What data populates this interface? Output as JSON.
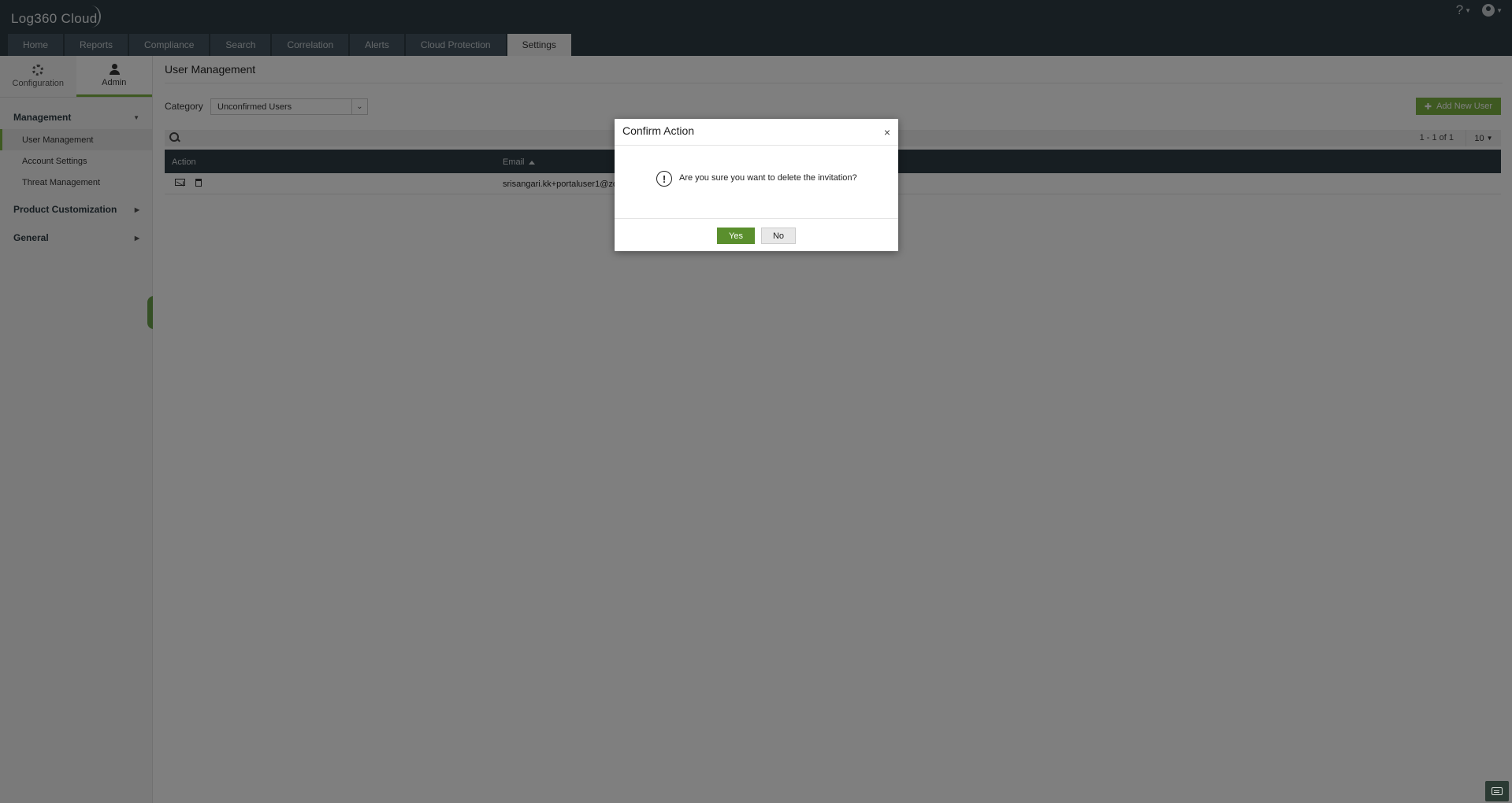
{
  "app": {
    "title": "Log360 Cloud"
  },
  "header": {
    "help": "?",
    "tabs": [
      {
        "label": "Home"
      },
      {
        "label": "Reports"
      },
      {
        "label": "Compliance"
      },
      {
        "label": "Search"
      },
      {
        "label": "Correlation"
      },
      {
        "label": "Alerts"
      },
      {
        "label": "Cloud Protection"
      },
      {
        "label": "Settings",
        "active": true
      }
    ]
  },
  "sidebar": {
    "tabs": [
      {
        "label": "Configuration",
        "icon": "gear-icon"
      },
      {
        "label": "Admin",
        "icon": "user-icon",
        "active": true
      }
    ],
    "sections": [
      {
        "label": "Management",
        "expanded": true,
        "items": [
          {
            "label": "User Management",
            "active": true
          },
          {
            "label": "Account Settings"
          },
          {
            "label": "Threat Management"
          }
        ]
      },
      {
        "label": "Product Customization",
        "expanded": false
      },
      {
        "label": "General",
        "expanded": false
      }
    ]
  },
  "main": {
    "page_title": "User Management",
    "category_label": "Category",
    "category_value": "Unconfirmed Users",
    "add_button": "Add New User",
    "pagination": "1 - 1 of 1",
    "page_size": "10",
    "columns": [
      "Action",
      "Email"
    ],
    "rows": [
      {
        "email": "srisangari.kk+portaluser1@zo"
      }
    ]
  },
  "dialog": {
    "title": "Confirm Action",
    "close": "×",
    "message": "Are you sure you want to delete the invitation?",
    "warn_glyph": "!",
    "yes": "Yes",
    "no": "No"
  },
  "colors": {
    "header_bg": "#2e3c44",
    "accent_green": "#7cb342",
    "yes_button": "#5a8f2d"
  }
}
